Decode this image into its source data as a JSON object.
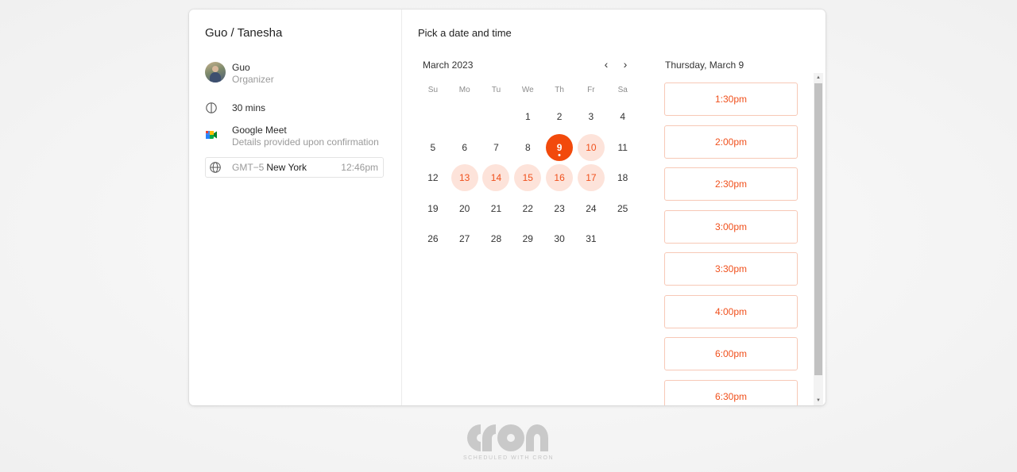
{
  "event": {
    "title": "Guo / Tanesha",
    "organizer_name": "Guo",
    "organizer_role": "Organizer",
    "duration": "30 mins",
    "location_name": "Google Meet",
    "location_detail": "Details provided upon confirmation",
    "timezone_offset": "GMT−5",
    "timezone_city": "New York",
    "timezone_time": "12:46pm"
  },
  "picker": {
    "title": "Pick a date and time",
    "month_label": "March 2023",
    "prev_label": "‹",
    "next_label": "›",
    "weekdays": [
      "Su",
      "Mo",
      "Tu",
      "We",
      "Th",
      "Fr",
      "Sa"
    ],
    "leading_blanks": 3,
    "days_in_month": 31,
    "selected_day": 9,
    "available_days": [
      10,
      13,
      14,
      15,
      16,
      17
    ]
  },
  "slots": {
    "heading": "Thursday, March 9",
    "times": [
      "1:30pm",
      "2:00pm",
      "2:30pm",
      "3:00pm",
      "3:30pm",
      "4:00pm",
      "6:00pm",
      "6:30pm"
    ]
  },
  "footer": {
    "caption": "SCHEDULED WITH CRON"
  },
  "colors": {
    "accent": "#f24a0c",
    "accent_soft": "#fde3da",
    "slot_border": "#f7c8b6"
  }
}
